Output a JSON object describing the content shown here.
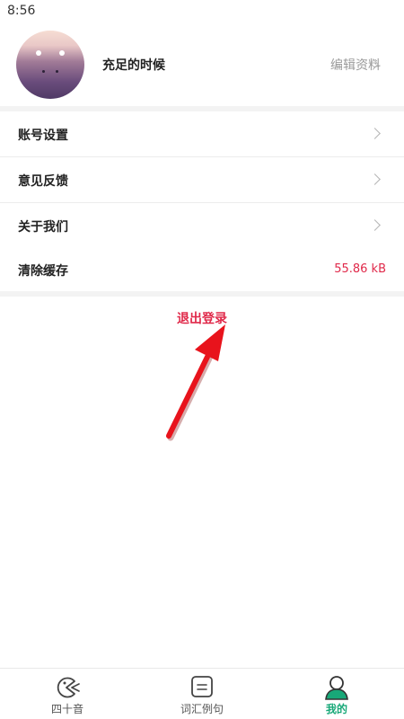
{
  "status_bar": {
    "time": "8:56"
  },
  "profile": {
    "username": "充足的时候",
    "edit_label": "编辑资料"
  },
  "menu": [
    {
      "label": "账号设置",
      "has_chevron": true
    },
    {
      "label": "意见反馈",
      "has_chevron": true
    },
    {
      "label": "关于我们",
      "has_chevron": true
    },
    {
      "label": "清除缓存",
      "value": "55.86 kB"
    }
  ],
  "logout_label": "退出登录",
  "tabs": [
    {
      "label": "四十音",
      "icon": "pacman-icon",
      "active": false
    },
    {
      "label": "词汇例句",
      "icon": "document-icon",
      "active": false
    },
    {
      "label": "我的",
      "icon": "user-icon",
      "active": true
    }
  ],
  "colors": {
    "accent_red": "#e0294a",
    "active_green": "#18a878",
    "arrow_red": "#e8131c"
  }
}
